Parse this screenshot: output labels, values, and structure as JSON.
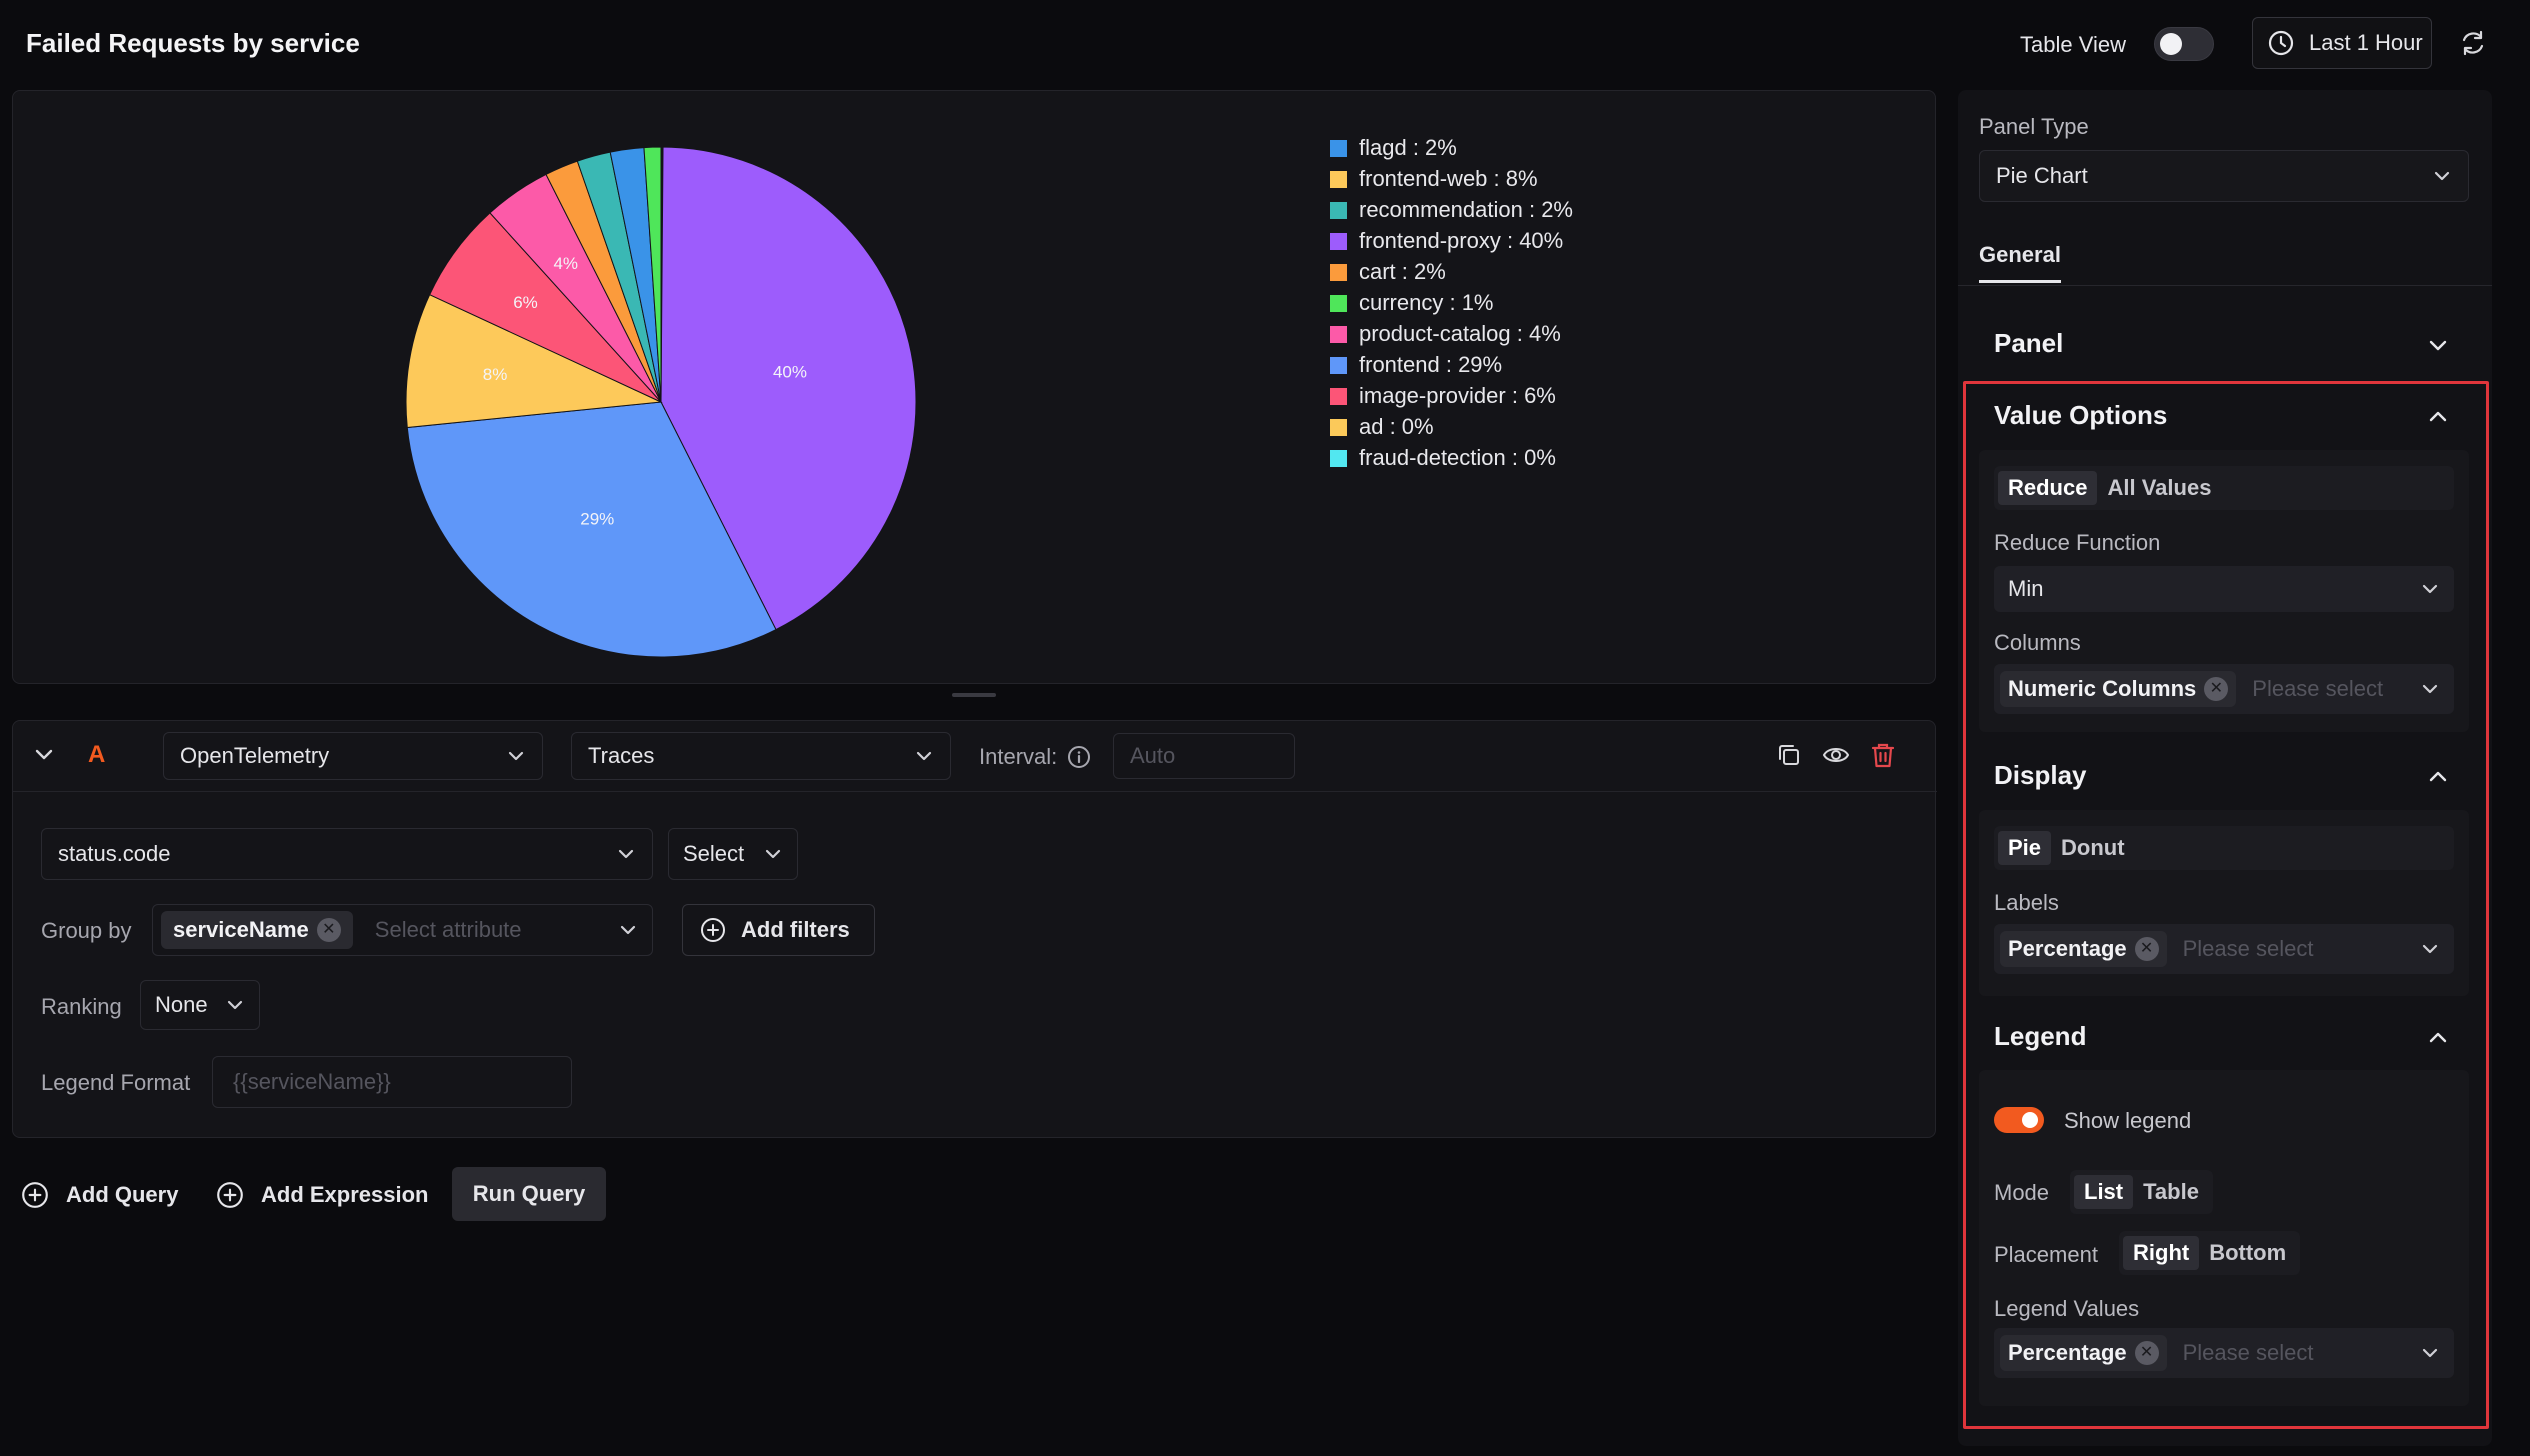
{
  "header": {
    "title": "Failed Requests by service",
    "table_view_label": "Table View",
    "time_range_label": "Last 1 Hour"
  },
  "colors": {
    "accent_orange": "#f25a1f",
    "highlight_border": "#e0353b",
    "delete_red": "#e5484d"
  },
  "chart_data": {
    "type": "pie",
    "slices": [
      {
        "name": "flagd",
        "value": 2,
        "label": "flagd : 2%",
        "color": "#3a93e8"
      },
      {
        "name": "frontend-web",
        "value": 8,
        "label": "frontend-web : 8%",
        "color": "#fdc95a"
      },
      {
        "name": "recommendation",
        "value": 2,
        "label": "recommendation : 2%",
        "color": "#3ab8b4"
      },
      {
        "name": "frontend-proxy",
        "value": 40,
        "label": "frontend-proxy : 40%",
        "color": "#9d5cfc"
      },
      {
        "name": "cart",
        "value": 2,
        "label": "cart : 2%",
        "color": "#fb9b3c"
      },
      {
        "name": "currency",
        "value": 1,
        "label": "currency : 1%",
        "color": "#4fe65a"
      },
      {
        "name": "product-catalog",
        "value": 4,
        "label": "product-catalog : 4%",
        "color": "#fc5aa8"
      },
      {
        "name": "frontend",
        "value": 29,
        "label": "frontend : 29%",
        "color": "#5f97f9"
      },
      {
        "name": "image-provider",
        "value": 6,
        "label": "image-provider : 6%",
        "color": "#fc5577"
      },
      {
        "name": "ad",
        "value": 0,
        "label": "ad : 0%",
        "color": "#fbc95a"
      },
      {
        "name": "fraud-detection",
        "value": 0,
        "label": "fraud-detection : 0%",
        "color": "#52e7f0"
      }
    ],
    "slice_labels": [
      "40%",
      "29%",
      "8%",
      "6%",
      "4%"
    ],
    "legend_placement": "right"
  },
  "query": {
    "letter": "A",
    "data_source": "OpenTelemetry",
    "signal": "Traces",
    "interval_label": "Interval:",
    "interval_placeholder": "Auto",
    "metric_field": "status.code",
    "aggregate": "Select",
    "group_by_label": "Group by",
    "group_by_chip": "serviceName",
    "group_by_placeholder": "Select attribute",
    "add_filters": "Add filters",
    "ranking_label": "Ranking",
    "ranking_value": "None",
    "legend_format_label": "Legend Format",
    "legend_format_placeholder": "{{serviceName}}"
  },
  "actions": {
    "add_query": "Add Query",
    "add_expression": "Add Expression",
    "run_query": "Run Query"
  },
  "side": {
    "panel_type_label": "Panel Type",
    "panel_type_value": "Pie Chart",
    "tab_general": "General",
    "panel_section": "Panel",
    "value_options": {
      "title": "Value Options",
      "seg_reduce": "Reduce",
      "seg_all": "All Values",
      "reduce_fn_label": "Reduce Function",
      "reduce_fn_value": "Min",
      "columns_label": "Columns",
      "columns_chip": "Numeric Columns",
      "columns_placeholder": "Please select"
    },
    "display": {
      "title": "Display",
      "seg_pie": "Pie",
      "seg_donut": "Donut",
      "labels_label": "Labels",
      "labels_chip": "Percentage",
      "labels_placeholder": "Please select"
    },
    "legend": {
      "title": "Legend",
      "show_legend": "Show legend",
      "mode_label": "Mode",
      "mode_list": "List",
      "mode_table": "Table",
      "placement_label": "Placement",
      "placement_right": "Right",
      "placement_bottom": "Bottom",
      "values_label": "Legend Values",
      "values_chip": "Percentage",
      "values_placeholder": "Please select"
    }
  }
}
